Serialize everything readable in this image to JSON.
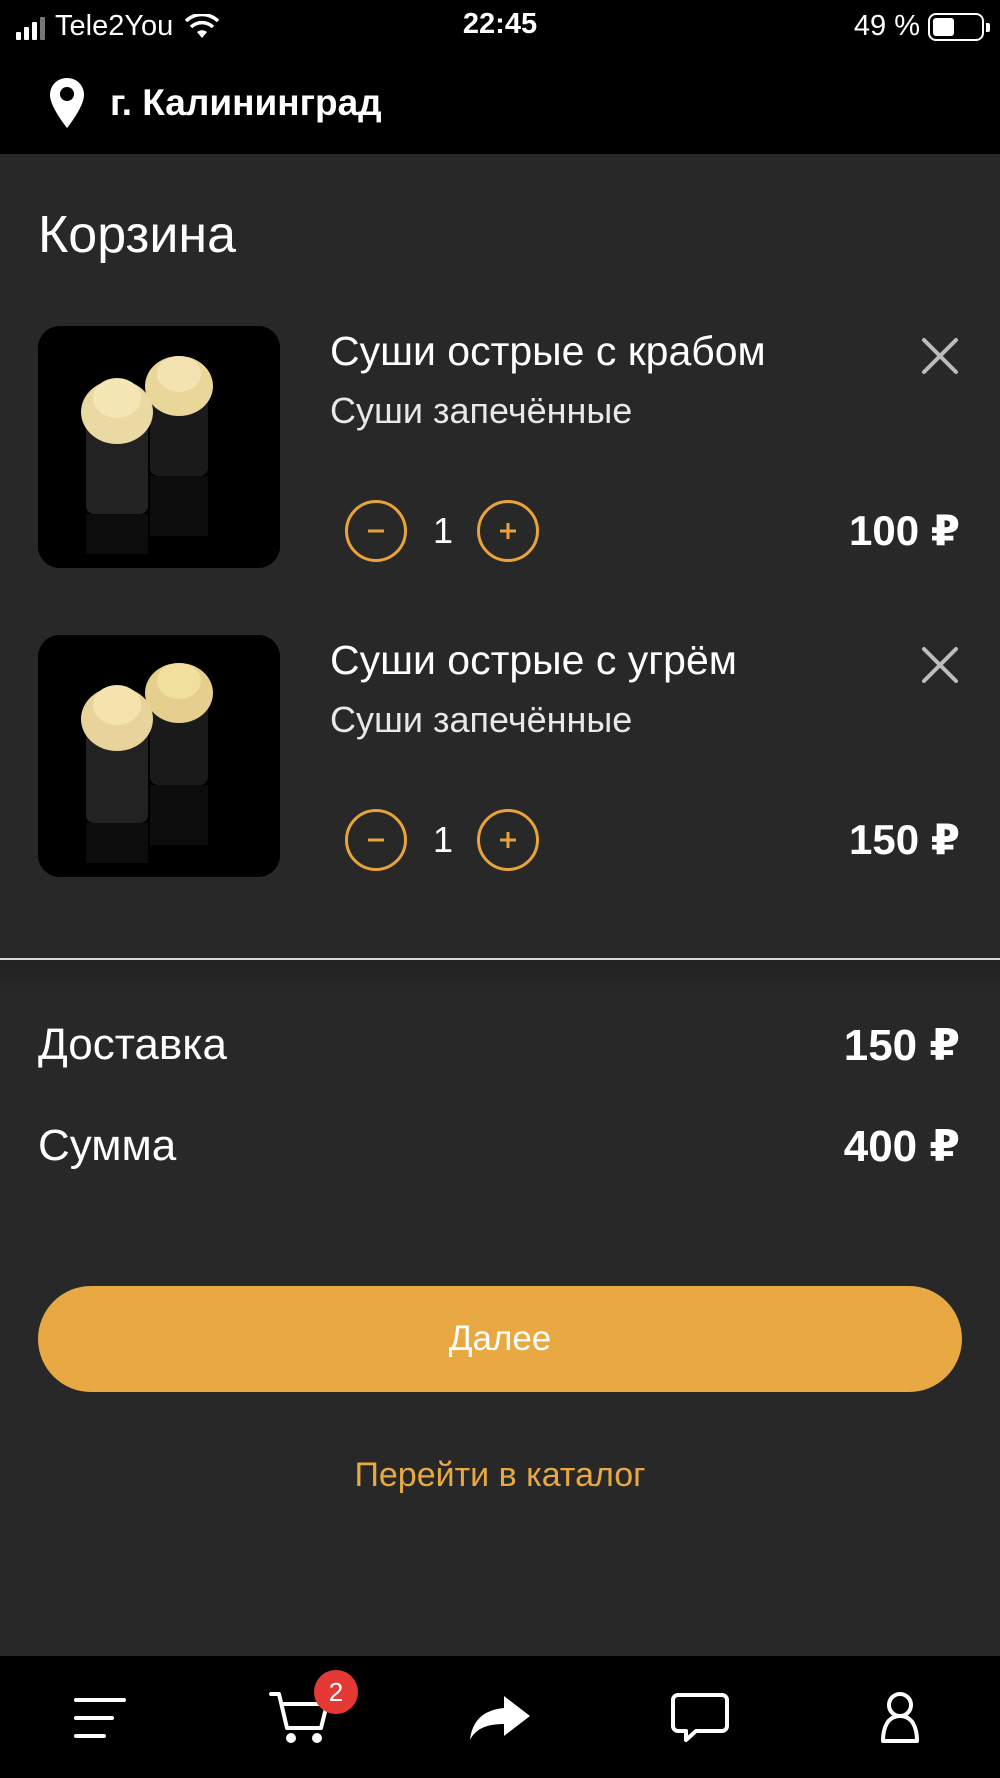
{
  "status_bar": {
    "carrier": "Tele2You",
    "time": "22:45",
    "battery": "49 %",
    "battery_level": 0.49
  },
  "header": {
    "location": "г. Калининград",
    "icon": "location-pin-icon"
  },
  "page_title": "Корзина",
  "cart": {
    "items": [
      {
        "name": "Суши острые с крабом",
        "category": "Суши запечённые",
        "quantity": "1",
        "price": "100 ₽"
      },
      {
        "name": "Суши острые с угрём",
        "category": "Суши запечённые",
        "quantity": "1",
        "price": "150 ₽"
      }
    ]
  },
  "summary": {
    "delivery_label": "Доставка",
    "delivery_value": "150 ₽",
    "total_label": "Сумма",
    "total_value": "400 ₽"
  },
  "actions": {
    "next_label": "Далее",
    "catalog_label": "Перейти в каталог"
  },
  "bottom_nav": {
    "cart_badge": "2",
    "icons": [
      "menu-icon",
      "cart-icon",
      "share-icon",
      "chat-icon",
      "profile-icon"
    ]
  },
  "colors": {
    "accent": "#e8a842",
    "background": "#282828",
    "bar": "#000000",
    "badge": "#e53935"
  }
}
